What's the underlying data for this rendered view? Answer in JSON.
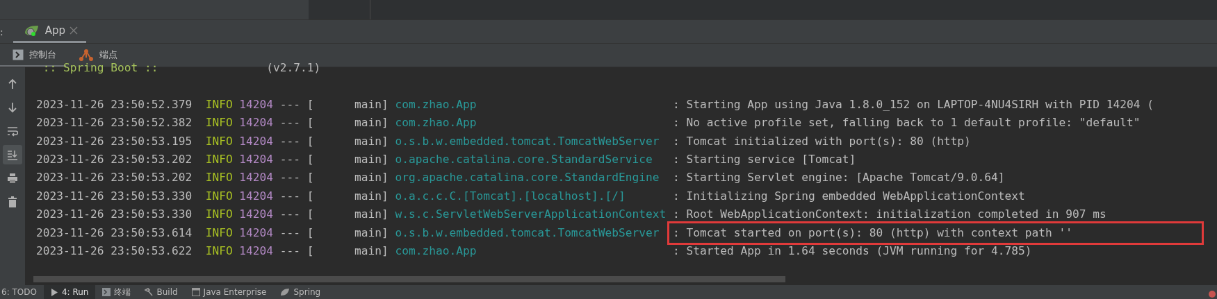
{
  "run_tabs": [
    {
      "prefix": ":"
    },
    {
      "label": "App",
      "selected": true
    }
  ],
  "console_tabs": [
    {
      "label": "控制台",
      "kind": "console",
      "selected": true
    },
    {
      "label": "端点",
      "kind": "endpoints",
      "selected": false
    }
  ],
  "gutter_tools": [
    {
      "kind": "up",
      "selected": false
    },
    {
      "kind": "down",
      "selected": false
    },
    {
      "kind": "wrap",
      "selected": false
    },
    {
      "kind": "scroll-end",
      "selected": true
    },
    {
      "kind": "print",
      "selected": false
    },
    {
      "kind": "trash",
      "selected": false
    }
  ],
  "banner": {
    "name": ":: Spring Boot ::",
    "version": "(v2.7.1)"
  },
  "log_rows": [
    {
      "time": "2023-11-26 23:50:52.379",
      "level": "INFO",
      "pid": "14204",
      "sep": "--- [",
      "thread": "main]",
      "logger": "com.zhao.App",
      "message": ": Starting App using Java 1.8.0_152 on LAPTOP-4NU4SIRH with PID 14204 (",
      "highlighted": false
    },
    {
      "time": "2023-11-26 23:50:52.382",
      "level": "INFO",
      "pid": "14204",
      "sep": "--- [",
      "thread": "main]",
      "logger": "com.zhao.App",
      "message": ": No active profile set, falling back to 1 default profile: \"default\"",
      "highlighted": false
    },
    {
      "time": "2023-11-26 23:50:53.195",
      "level": "INFO",
      "pid": "14204",
      "sep": "--- [",
      "thread": "main]",
      "logger": "o.s.b.w.embedded.tomcat.TomcatWebServer",
      "message": ": Tomcat initialized with port(s): 80 (http)",
      "highlighted": false
    },
    {
      "time": "2023-11-26 23:50:53.202",
      "level": "INFO",
      "pid": "14204",
      "sep": "--- [",
      "thread": "main]",
      "logger": "o.apache.catalina.core.StandardService",
      "message": ": Starting service [Tomcat]",
      "highlighted": false
    },
    {
      "time": "2023-11-26 23:50:53.202",
      "level": "INFO",
      "pid": "14204",
      "sep": "--- [",
      "thread": "main]",
      "logger": "org.apache.catalina.core.StandardEngine",
      "message": ": Starting Servlet engine: [Apache Tomcat/9.0.64]",
      "highlighted": false
    },
    {
      "time": "2023-11-26 23:50:53.330",
      "level": "INFO",
      "pid": "14204",
      "sep": "--- [",
      "thread": "main]",
      "logger": "o.a.c.c.C.[Tomcat].[localhost].[/]",
      "message": ": Initializing Spring embedded WebApplicationContext",
      "highlighted": false
    },
    {
      "time": "2023-11-26 23:50:53.330",
      "level": "INFO",
      "pid": "14204",
      "sep": "--- [",
      "thread": "main]",
      "logger": "w.s.c.ServletWebServerApplicationContext",
      "message": ": Root WebApplicationContext: initialization completed in 907 ms",
      "highlighted": false
    },
    {
      "time": "2023-11-26 23:50:53.614",
      "level": "INFO",
      "pid": "14204",
      "sep": "--- [",
      "thread": "main]",
      "logger": "o.s.b.w.embedded.tomcat.TomcatWebServer",
      "message": ": Tomcat started on port(s): 80 (http) with context path ''",
      "highlighted": true
    },
    {
      "time": "2023-11-26 23:50:53.622",
      "level": "INFO",
      "pid": "14204",
      "sep": "--- [",
      "thread": "main]",
      "logger": "com.zhao.App",
      "message": ": Started App in 1.64 seconds (JVM running for 4.785)",
      "highlighted": false
    }
  ],
  "tool_windows": [
    {
      "label": "6: TODO",
      "kind": "todo",
      "selected": false
    },
    {
      "label": "4: Run",
      "kind": "run",
      "selected": true
    },
    {
      "label": "终端",
      "kind": "terminal",
      "selected": false
    },
    {
      "label": "Build",
      "kind": "build",
      "selected": false
    },
    {
      "label": "Java Enterprise",
      "kind": "enterprise",
      "selected": false
    },
    {
      "label": "Spring",
      "kind": "spring",
      "selected": false
    }
  ]
}
